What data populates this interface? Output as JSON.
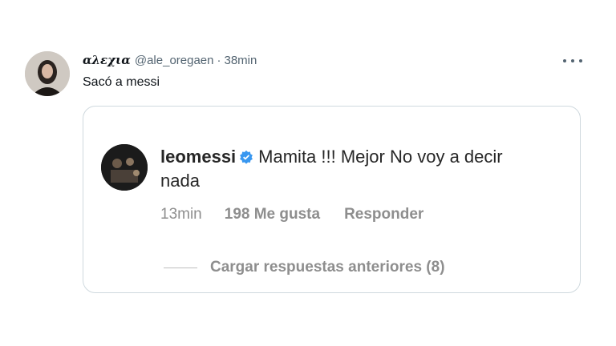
{
  "tweet": {
    "display_name": "αλεχια",
    "handle": "@ale_oregaen",
    "separator": "·",
    "time": "38min",
    "text": "Sacó a messi",
    "more_icon": "more-horizontal-icon"
  },
  "embed": {
    "username": "leomessi",
    "verified_icon": "verified-badge-icon",
    "verified_color": "#3897f0",
    "comment": "Mamita !!! Mejor No voy a decir nada",
    "time": "13min",
    "likes": "198 Me gusta",
    "reply_label": "Responder",
    "load_more_label": "Cargar respuestas anteriores (8)"
  }
}
